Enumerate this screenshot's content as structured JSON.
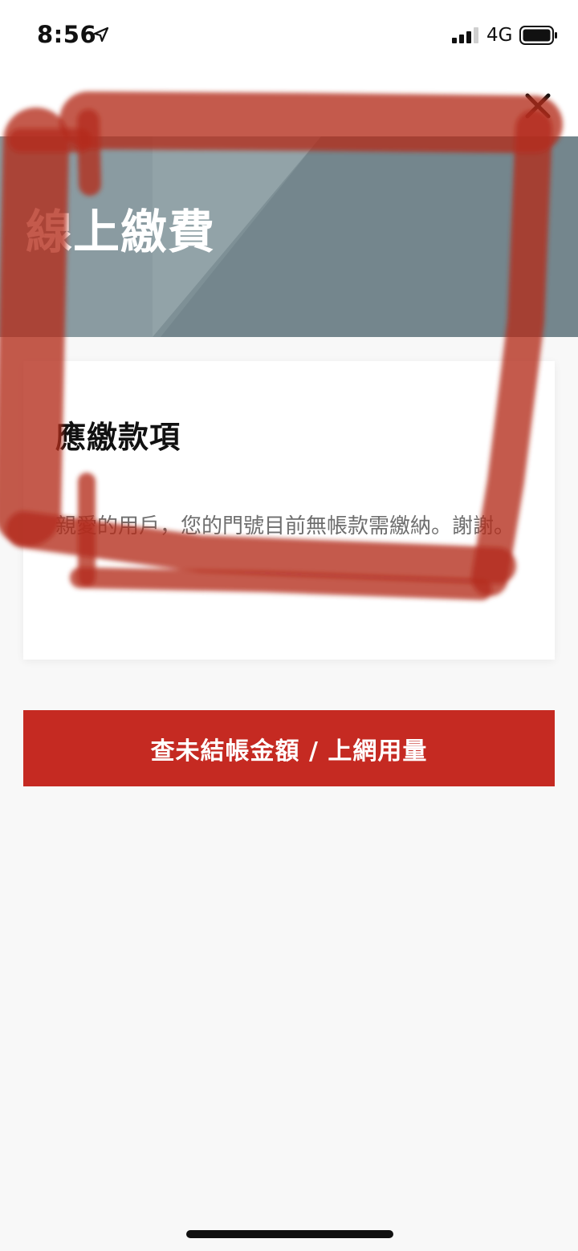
{
  "status_bar": {
    "time": "8:56",
    "network": "4G"
  },
  "banner": {
    "title": "線上繳費"
  },
  "card": {
    "title": "應繳款項",
    "message": "親愛的用戶，您的門號目前無帳款需繳納。謝謝。"
  },
  "actions": {
    "check_unbilled_label": "查未結帳金額 / 上網用量"
  },
  "colors": {
    "accent": "#c52a22",
    "banner": "#7b8d94",
    "annotation": "#b42a1c"
  },
  "icons": {
    "close": "close-icon",
    "location": "location-arrow-icon",
    "signal": "signal-icon",
    "battery": "battery-icon"
  }
}
